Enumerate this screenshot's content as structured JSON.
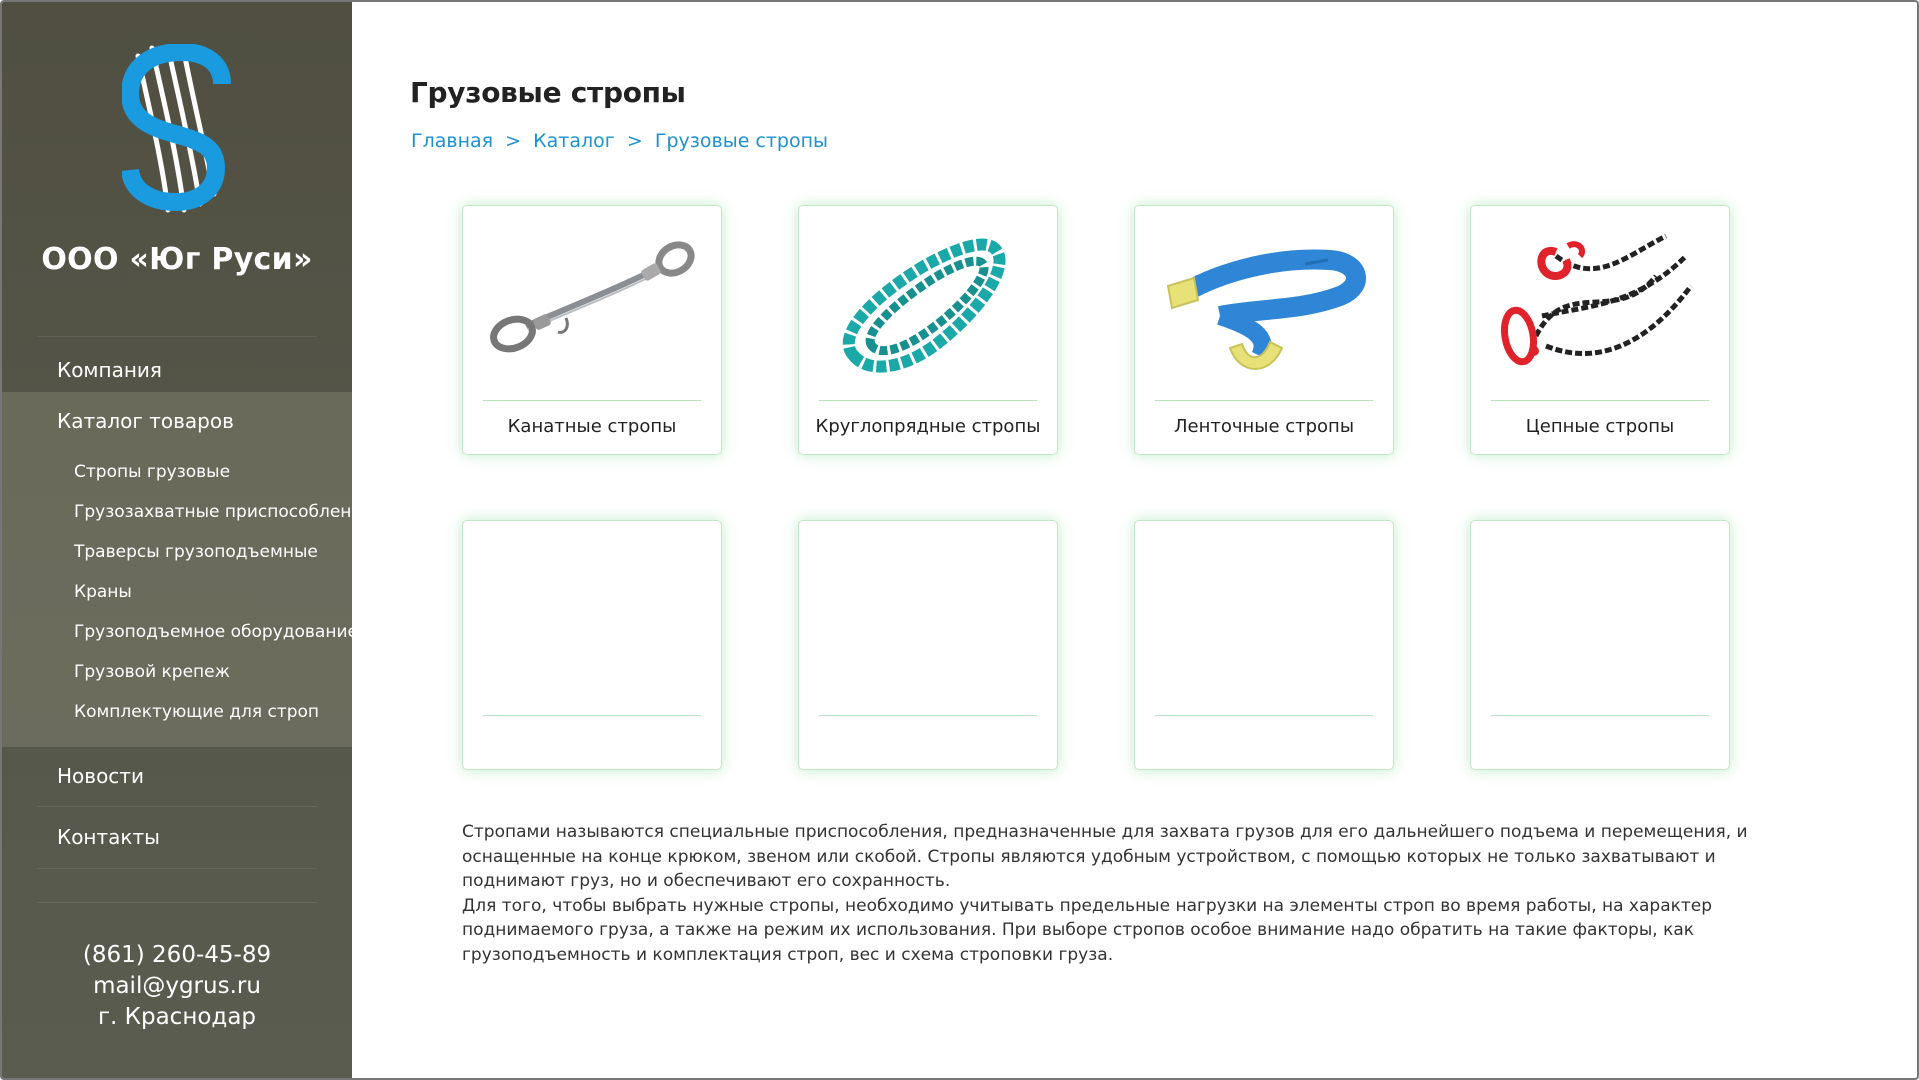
{
  "company": {
    "name": "ООО «Юг Руси»"
  },
  "nav": {
    "company": "Компания",
    "catalog": "Каталог товаров",
    "catalog_items": [
      "Стропы грузовые",
      "Грузозахватные приспособления",
      "Траверсы грузоподъемные",
      "Краны",
      "Грузоподъемное оборудование",
      "Грузовой крепеж",
      "Комплектующие для строп"
    ],
    "news": "Новости",
    "contacts": "Контакты"
  },
  "contacts": {
    "phone": "(861) 260-45-89",
    "email": "mail@ygrus.ru",
    "city": "г. Краснодар"
  },
  "page": {
    "title": "Грузовые стропы",
    "breadcrumb": [
      "Главная",
      "Каталог",
      "Грузовые стропы"
    ],
    "breadcrumb_separator": ">"
  },
  "products": [
    {
      "label": "Канатные стропы",
      "icon": "wire-rope-sling-image"
    },
    {
      "label": "Круглопрядные стропы",
      "icon": "round-sling-image"
    },
    {
      "label": "Ленточные стропы",
      "icon": "webbing-sling-image"
    },
    {
      "label": "Цепные стропы",
      "icon": "chain-sling-image"
    },
    {
      "label": ""
    },
    {
      "label": ""
    },
    {
      "label": ""
    },
    {
      "label": ""
    }
  ],
  "description": {
    "p1": "Стропами называются специальные приспособления, предназначенные для захвата грузов для его дальнейшего подъема и перемещения, и оснащенные на конце крюком, звеном или скобой. Стропы являются удобным  устройством, с помощью которых не только захватывают и поднимают груз, но и обеспечивают его сохранность.",
    "p2": "Для того, чтобы выбрать нужные стропы, необходимо учитывать предельные нагрузки на элементы строп во время работы, на характер поднимаемого груза, а также на режим их использования. При выборе стропов особое внимание надо обратить на такие факторы, как грузоподъемность и комплектация строп, вес и схема строповки груза."
  },
  "colors": {
    "sidebar": "#55564a",
    "sidebar_active": "#6a6a5a",
    "link": "#1a92d3",
    "logo_blue": "#1a9be0",
    "card_glow": "#50c864"
  }
}
